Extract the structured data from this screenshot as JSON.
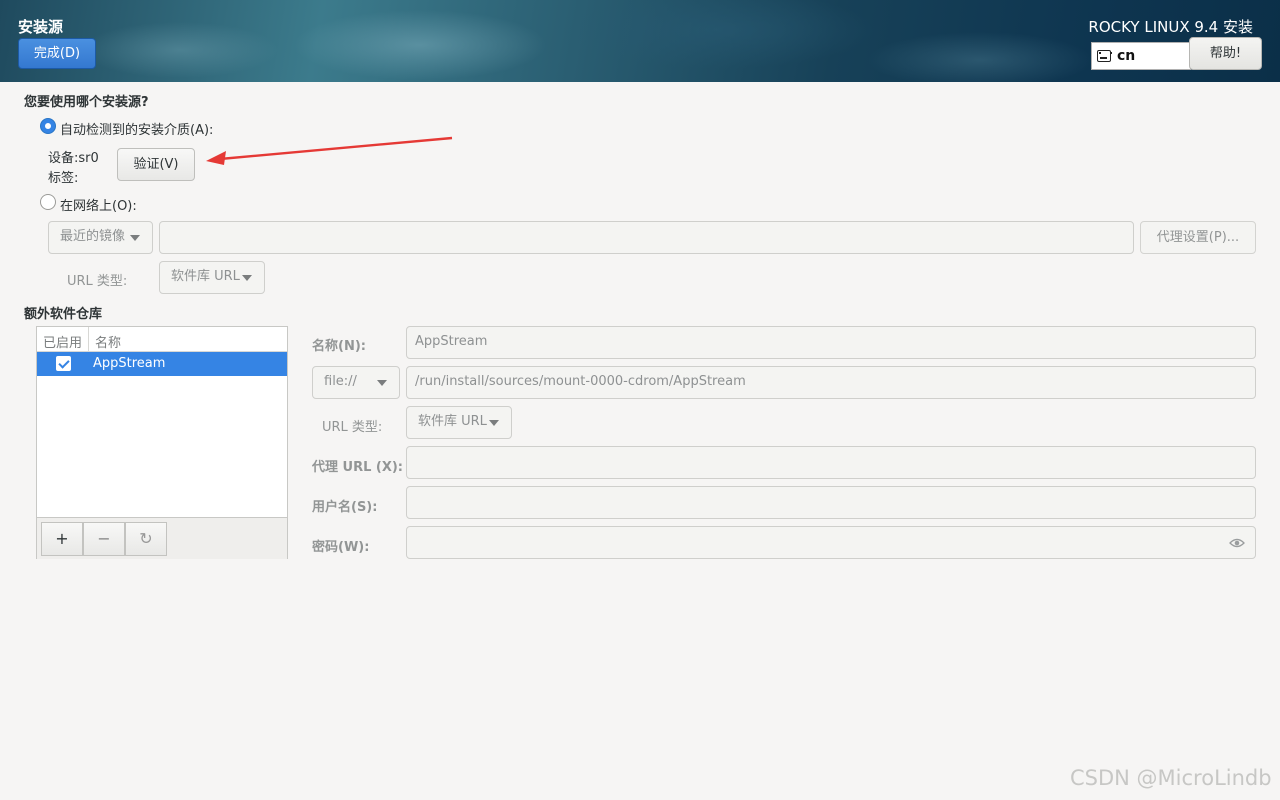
{
  "header": {
    "spoke_title": "安装源",
    "done_label": "完成(D)",
    "product_title": "ROCKY LINUX 9.4 安装",
    "keyboard_layout": "cn",
    "help_label": "帮助!"
  },
  "source": {
    "question": "您要使用哪个安装源?",
    "auto_option_label": "自动检测到的安装介质(A):",
    "device_label": "设备:",
    "device_value": "sr0",
    "label_label": "标签:",
    "verify_label": "验证(V)",
    "network_option_label": "在网络上(O):",
    "mirror_combo": "最近的镜像",
    "url_value": "",
    "proxy_label": "代理设置(P)...",
    "url_type_label": "URL 类型:",
    "url_type_combo": "软件库 URL",
    "selected_option": "auto"
  },
  "extra_repos": {
    "title": "额外软件仓库",
    "columns": [
      "已启用",
      "名称"
    ],
    "rows": [
      {
        "enabled": true,
        "name": "AppStream"
      }
    ],
    "toolbar": {
      "add": "+",
      "remove": "−",
      "refresh": "↻"
    }
  },
  "repo_detail": {
    "name_label": "名称(N):",
    "name_value": "AppStream",
    "protocol_combo": "file://",
    "path_value": "/run/install/sources/mount-0000-cdrom/AppStream",
    "url_type_label": "URL 类型:",
    "url_type_combo": "软件库 URL",
    "proxy_url_label": "代理 URL (X):",
    "proxy_url_value": "",
    "username_label": "用户名(S):",
    "username_value": "",
    "password_label": "密码(W):",
    "password_value": ""
  },
  "watermark": "CSDN @MicroLindb",
  "colors": {
    "accent": "#3584e4",
    "annotation_arrow": "#e53935"
  }
}
